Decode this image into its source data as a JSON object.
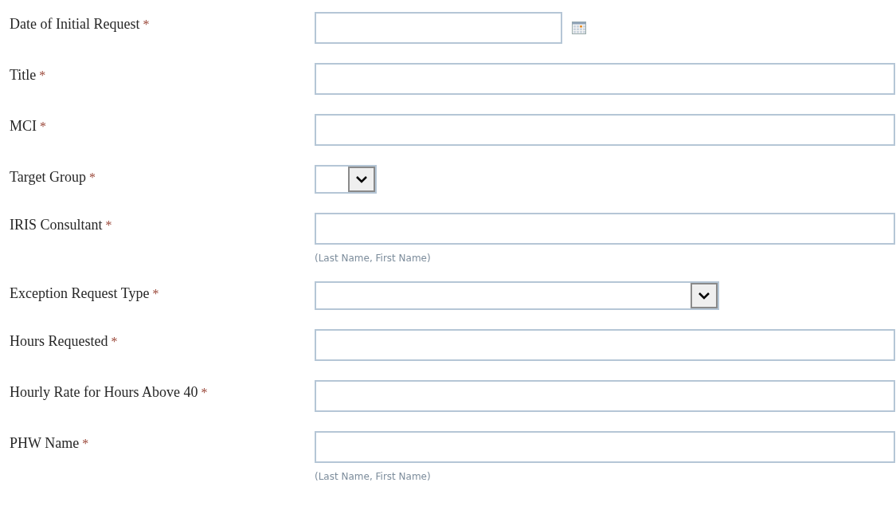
{
  "fields": [
    {
      "label": "Date of Initial Request",
      "marker": "*",
      "kind": "date"
    },
    {
      "label": "Title",
      "marker": "*",
      "kind": "text"
    },
    {
      "label": "MCI",
      "marker": "*",
      "kind": "text"
    },
    {
      "label": "Target Group",
      "marker": "*",
      "kind": "dropdown_small"
    },
    {
      "label": "IRIS Consultant",
      "marker": "*",
      "kind": "text",
      "hint": "(Last Name, First Name)"
    },
    {
      "label": "Exception Request Type",
      "marker": "*",
      "kind": "dropdown"
    },
    {
      "label": "Hours Requested",
      "marker": "*",
      "kind": "text"
    },
    {
      "label": "Hourly Rate for Hours Above 40",
      "marker": "*",
      "kind": "text"
    },
    {
      "label": "PHW Name",
      "marker": "*",
      "kind": "text",
      "hint": "(Last Name, First Name)"
    }
  ]
}
